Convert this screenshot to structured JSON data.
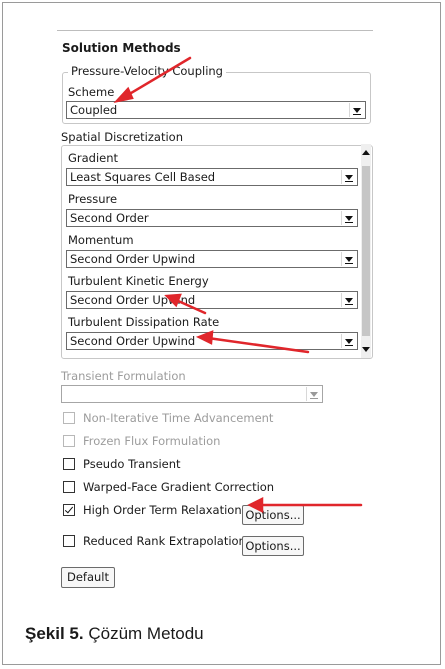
{
  "panel_title": "Solution Methods",
  "pv_coupling": {
    "legend": "Pressure-Velocity Coupling",
    "scheme_label": "Scheme",
    "scheme_value": "Coupled"
  },
  "spatial": {
    "legend": "Spatial Discretization",
    "fields": [
      {
        "label": "Gradient",
        "value": "Least Squares Cell Based"
      },
      {
        "label": "Pressure",
        "value": "Second Order"
      },
      {
        "label": "Momentum",
        "value": "Second Order Upwind"
      },
      {
        "label": "Turbulent Kinetic Energy",
        "value": "Second Order Upwind"
      },
      {
        "label": "Turbulent Dissipation Rate",
        "value": "Second Order Upwind"
      }
    ]
  },
  "transient": {
    "label": "Transient Formulation",
    "value": ""
  },
  "options": [
    {
      "label": "Non-Iterative Time Advancement",
      "checked": false,
      "enabled": false
    },
    {
      "label": "Frozen Flux Formulation",
      "checked": false,
      "enabled": false
    },
    {
      "label": "Pseudo Transient",
      "checked": false,
      "enabled": true
    },
    {
      "label": "Warped-Face Gradient Correction",
      "checked": false,
      "enabled": true
    },
    {
      "label": "High Order Term Relaxation",
      "checked": true,
      "enabled": true
    },
    {
      "label": "Reduced Rank Extrapolation",
      "checked": false,
      "enabled": true
    }
  ],
  "buttons": {
    "options_1": "Options...",
    "options_2": "Options...",
    "default": "Default"
  },
  "caption": {
    "prefix": "Şekil 5.",
    "text": " Çözüm Metodu"
  },
  "colors": {
    "annotation_arrow": "#e0262b"
  }
}
